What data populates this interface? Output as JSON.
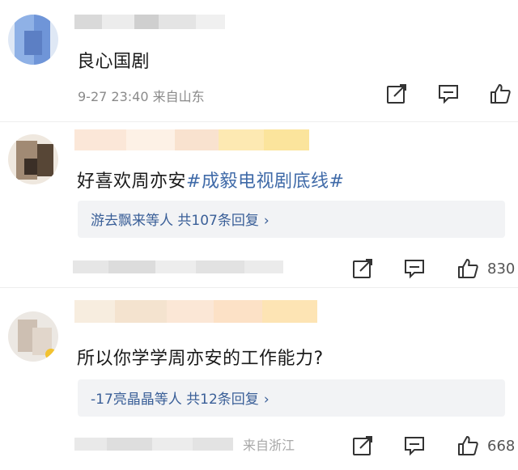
{
  "comments": [
    {
      "text": "良心国剧",
      "meta": "9-27 23:40 来自山东"
    },
    {
      "text": "好喜欢周亦安",
      "tag": "#成毅电视剧底线#",
      "replies": {
        "label": "游去飘来等人 共107条回复",
        "chevron": "›"
      },
      "like_count": "830"
    },
    {
      "text": "所以你学学周亦安的工作能力?",
      "replies": {
        "label": "-17亮晶晶等人 共12条回复",
        "chevron": "›"
      },
      "meta_partial": "来自浙江",
      "like_count": "668"
    }
  ],
  "icons": {
    "share": "share-icon",
    "comment": "comment-icon",
    "like": "thumbs-up-icon"
  },
  "colors": {
    "tag": "#3f6aa8",
    "reply_text": "#3a5f98",
    "reply_bg": "#f2f3f5",
    "meta": "#8a8a8a"
  }
}
